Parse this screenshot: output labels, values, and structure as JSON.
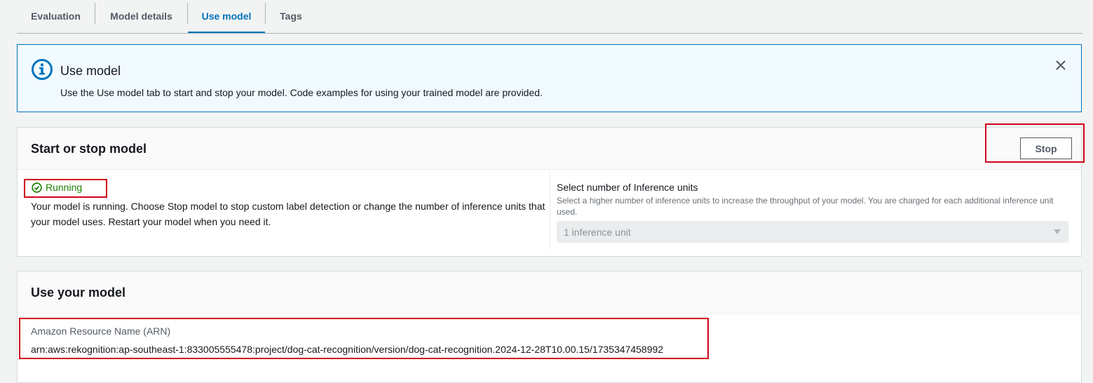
{
  "tabs": [
    {
      "label": "Evaluation"
    },
    {
      "label": "Model details"
    },
    {
      "label": "Use model"
    },
    {
      "label": "Tags"
    }
  ],
  "info": {
    "title": "Use model",
    "text": "Use the Use model tab to start and stop your model. Code examples for using your trained model are provided.",
    "icon": "info-icon",
    "close_icon": "close-icon"
  },
  "start_stop": {
    "title": "Start or stop model",
    "stop_label": "Stop",
    "status": "Running",
    "status_icon": "check-circle-icon",
    "description": "Your model is running. Choose Stop model to stop custom label detection or change the number of inference units that your model uses. Restart your model when you need it.",
    "inference": {
      "label": "Select number of Inference units",
      "hint": "Select a higher number of inference units to increase the throughput of your model. You are charged for each additional inference unit used.",
      "selected": "1 inference unit"
    }
  },
  "use_model": {
    "title": "Use your model",
    "arn_label": "Amazon Resource Name (ARN)",
    "arn_value": "arn:aws:rekognition:ap-southeast-1:833005555478:project/dog-cat-recognition/version/dog-cat-recognition.2024-12-28T10.00.15/1735347458992"
  },
  "colors": {
    "accent": "#0073bb",
    "success": "#1d8102",
    "highlight": "#d0021b",
    "info_bg": "#f1faff"
  }
}
